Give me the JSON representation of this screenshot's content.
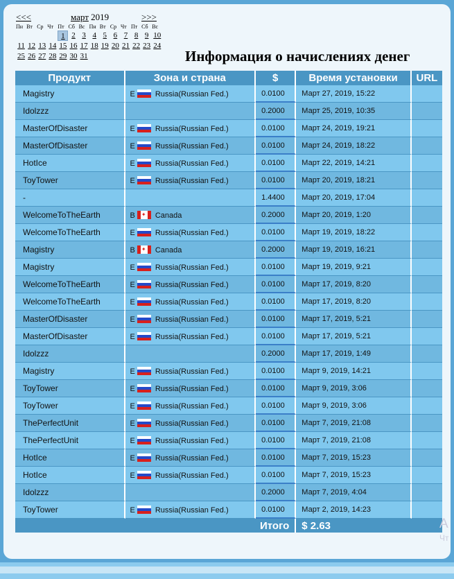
{
  "calendar": {
    "prev": "<<<",
    "month": "март",
    "year": "2019",
    "next": ">>>",
    "weekdays": [
      "Пн",
      "Вт",
      "Ср",
      "Чт",
      "Пт",
      "Сб",
      "Вс",
      "Пн",
      "Вт",
      "Ср",
      "Чт",
      "Пт",
      "Сб",
      "Вс"
    ],
    "selected_day": "1",
    "rows": [
      [
        "",
        "",
        "",
        "",
        "1",
        "2",
        "3",
        "4",
        "5",
        "6",
        "7",
        "8",
        "9",
        "10"
      ],
      [
        "11",
        "12",
        "13",
        "14",
        "15",
        "16",
        "17",
        "18",
        "19",
        "20",
        "21",
        "22",
        "23",
        "24"
      ],
      [
        "25",
        "26",
        "27",
        "28",
        "29",
        "30",
        "31",
        "",
        "",
        "",
        "",
        "",
        "",
        ""
      ]
    ]
  },
  "title": "Информация о начислениях денег",
  "table": {
    "headers": {
      "product": "Продукт",
      "zone": "Зона и страна",
      "amount": "$",
      "time": "Время установки",
      "url": "URL"
    },
    "rows": [
      {
        "product": "Magistry",
        "zone": "E",
        "flag": "ru",
        "country": "Russia(Russian Fed.)",
        "amount": "0.0100",
        "time": "Март 27, 2019, 15:22"
      },
      {
        "product": "Idolzzz",
        "zone": "",
        "flag": "",
        "country": "",
        "amount": "0.2000",
        "time": "Март 25, 2019, 10:35"
      },
      {
        "product": "MasterOfDisaster",
        "zone": "E",
        "flag": "ru",
        "country": "Russia(Russian Fed.)",
        "amount": "0.0100",
        "time": "Март 24, 2019, 19:21"
      },
      {
        "product": "MasterOfDisaster",
        "zone": "E",
        "flag": "ru",
        "country": "Russia(Russian Fed.)",
        "amount": "0.0100",
        "time": "Март 24, 2019, 18:22"
      },
      {
        "product": "HotIce",
        "zone": "E",
        "flag": "ru",
        "country": "Russia(Russian Fed.)",
        "amount": "0.0100",
        "time": "Март 22, 2019, 14:21"
      },
      {
        "product": "ToyTower",
        "zone": "E",
        "flag": "ru",
        "country": "Russia(Russian Fed.)",
        "amount": "0.0100",
        "time": "Март 20, 2019, 18:21"
      },
      {
        "product": "-",
        "zone": "",
        "flag": "",
        "country": "",
        "amount": "1.4400",
        "time": "Март 20, 2019, 17:04"
      },
      {
        "product": "WelcomeToTheEarth",
        "zone": "B",
        "flag": "ca",
        "country": "Canada",
        "amount": "0.2000",
        "time": "Март 20, 2019, 1:20"
      },
      {
        "product": "WelcomeToTheEarth",
        "zone": "E",
        "flag": "ru",
        "country": "Russia(Russian Fed.)",
        "amount": "0.0100",
        "time": "Март 19, 2019, 18:22"
      },
      {
        "product": "Magistry",
        "zone": "B",
        "flag": "ca",
        "country": "Canada",
        "amount": "0.2000",
        "time": "Март 19, 2019, 16:21"
      },
      {
        "product": "Magistry",
        "zone": "E",
        "flag": "ru",
        "country": "Russia(Russian Fed.)",
        "amount": "0.0100",
        "time": "Март 19, 2019, 9:21"
      },
      {
        "product": "WelcomeToTheEarth",
        "zone": "E",
        "flag": "ru",
        "country": "Russia(Russian Fed.)",
        "amount": "0.0100",
        "time": "Март 17, 2019, 8:20"
      },
      {
        "product": "WelcomeToTheEarth",
        "zone": "E",
        "flag": "ru",
        "country": "Russia(Russian Fed.)",
        "amount": "0.0100",
        "time": "Март 17, 2019, 8:20"
      },
      {
        "product": "MasterOfDisaster",
        "zone": "E",
        "flag": "ru",
        "country": "Russia(Russian Fed.)",
        "amount": "0.0100",
        "time": "Март 17, 2019, 5:21"
      },
      {
        "product": "MasterOfDisaster",
        "zone": "E",
        "flag": "ru",
        "country": "Russia(Russian Fed.)",
        "amount": "0.0100",
        "time": "Март 17, 2019, 5:21"
      },
      {
        "product": "Idolzzz",
        "zone": "",
        "flag": "",
        "country": "",
        "amount": "0.2000",
        "time": "Март 17, 2019, 1:49"
      },
      {
        "product": "Magistry",
        "zone": "E",
        "flag": "ru",
        "country": "Russia(Russian Fed.)",
        "amount": "0.0100",
        "time": "Март 9, 2019, 14:21"
      },
      {
        "product": "ToyTower",
        "zone": "E",
        "flag": "ru",
        "country": "Russia(Russian Fed.)",
        "amount": "0.0100",
        "time": "Март 9, 2019, 3:06"
      },
      {
        "product": "ToyTower",
        "zone": "E",
        "flag": "ru",
        "country": "Russia(Russian Fed.)",
        "amount": "0.0100",
        "time": "Март 9, 2019, 3:06"
      },
      {
        "product": "ThePerfectUnit",
        "zone": "E",
        "flag": "ru",
        "country": "Russia(Russian Fed.)",
        "amount": "0.0100",
        "time": "Март 7, 2019, 21:08"
      },
      {
        "product": "ThePerfectUnit",
        "zone": "E",
        "flag": "ru",
        "country": "Russia(Russian Fed.)",
        "amount": "0.0100",
        "time": "Март 7, 2019, 21:08"
      },
      {
        "product": "HotIce",
        "zone": "E",
        "flag": "ru",
        "country": "Russia(Russian Fed.)",
        "amount": "0.0100",
        "time": "Март 7, 2019, 15:23"
      },
      {
        "product": "HotIce",
        "zone": "E",
        "flag": "ru",
        "country": "Russia(Russian Fed.)",
        "amount": "0.0100",
        "time": "Март 7, 2019, 15:23"
      },
      {
        "product": "Idolzzz",
        "zone": "",
        "flag": "",
        "country": "",
        "amount": "0.2000",
        "time": "Март 7, 2019, 4:04"
      },
      {
        "product": "ToyTower",
        "zone": "E",
        "flag": "ru",
        "country": "Russia(Russian Fed.)",
        "amount": "0.0100",
        "time": "Март 2, 2019, 14:23"
      }
    ],
    "total_label": "Итого",
    "total_value": "$ 2.63"
  },
  "ghost_text": {
    "line1": "A",
    "line2": "Чт"
  },
  "colors": {
    "header_bg": "#4a96c4",
    "row_light": "#80c8ee",
    "row_dark": "#70b8e0",
    "page_bg": "#5aa6d6",
    "panel_bg": "#eef6fb"
  }
}
